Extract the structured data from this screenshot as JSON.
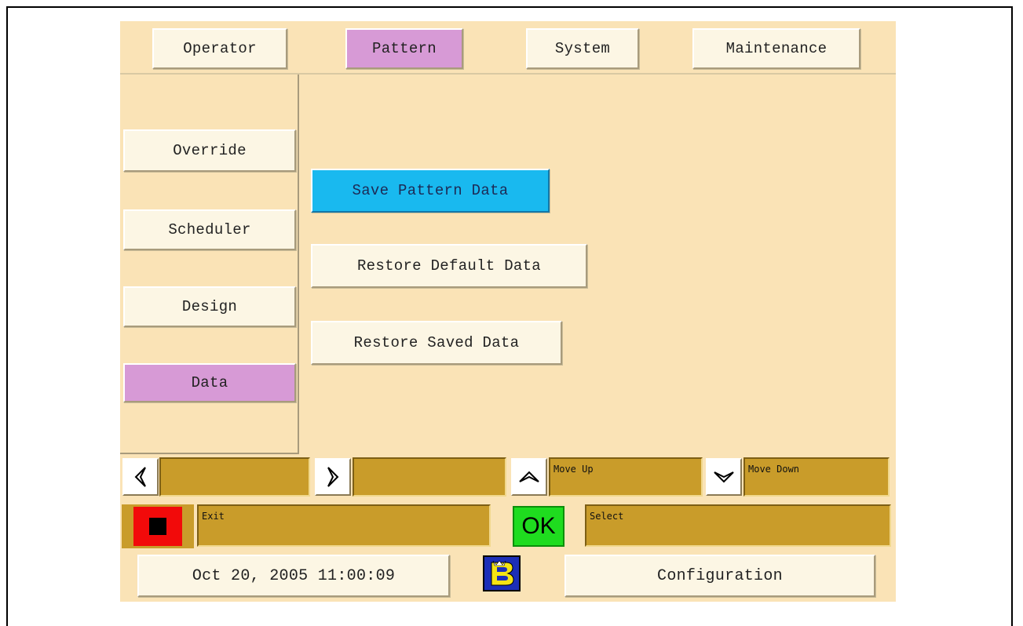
{
  "tabs": [
    {
      "label": "Operator",
      "selected": false
    },
    {
      "label": "Pattern",
      "selected": true
    },
    {
      "label": "System",
      "selected": false
    },
    {
      "label": "Maintenance",
      "selected": false
    }
  ],
  "sidebar": {
    "items": [
      {
        "label": "Override",
        "selected": false
      },
      {
        "label": "Scheduler",
        "selected": false
      },
      {
        "label": "Design",
        "selected": false
      },
      {
        "label": "Data",
        "selected": true
      }
    ]
  },
  "main": {
    "actions": [
      {
        "label": "Save Pattern Data",
        "focused": true
      },
      {
        "label": "Restore Default Data",
        "focused": false
      },
      {
        "label": "Restore Saved Data",
        "focused": false
      }
    ]
  },
  "hints": {
    "left_label": "",
    "right_label": "",
    "up_label": "Move Up",
    "down_label": "Move Down",
    "exit_label": "Exit",
    "ok_text": "OK",
    "select_label": "Select"
  },
  "footer": {
    "datetime": "Oct 20, 2005 11:00:09",
    "config_label": "Configuration"
  },
  "colors": {
    "background": "#fae3b6",
    "selected": "#d79ad6",
    "focus": "#19b9ef",
    "hint_field": "#c99c2a",
    "stop": "#f20a0a",
    "ok": "#1fdc1f",
    "logo": "#1c2fb8"
  },
  "icons": [
    "left-arrow-icon",
    "right-arrow-icon",
    "up-arrow-icon",
    "down-arrow-icon",
    "stop-icon",
    "brand-logo-icon"
  ]
}
